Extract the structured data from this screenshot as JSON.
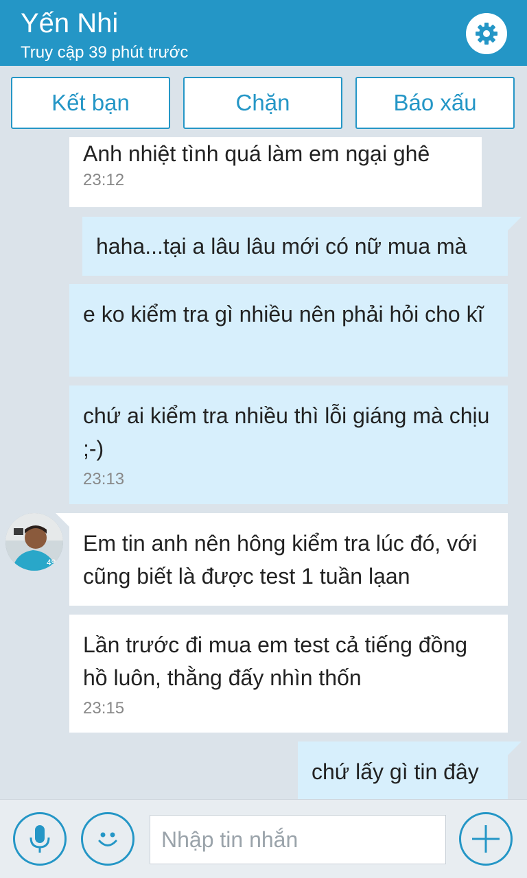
{
  "header": {
    "contact_name": "Yến Nhi",
    "last_seen": "Truy cập 39 phút trước",
    "settings_icon": "gear-icon"
  },
  "actions": {
    "add_friend": "Kết bạn",
    "block": "Chặn",
    "report": "Báo xấu"
  },
  "messages": [
    {
      "direction": "in",
      "text": "Anh nhiệt tình quá làm em ngại ghê",
      "time": "23:12"
    },
    {
      "direction": "out",
      "text": "haha...tại a lâu lâu mới có nữ mua mà",
      "time": ""
    },
    {
      "direction": "out",
      "text": "e ko kiểm tra gì nhiều nên phải hỏi cho kĩ",
      "time": ""
    },
    {
      "direction": "out",
      "text": "chứ ai kiểm tra nhiều thì lỗi giáng mà chịu ;-)",
      "time": "23:13"
    },
    {
      "direction": "in",
      "text": "Em tin anh nên hông kiểm tra lúc đó, với cũng biết là được test 1 tuần lạan",
      "time": ""
    },
    {
      "direction": "in",
      "text": "Lần trước đi mua em test cả tiếng đồng hồ luôn, thằng đấy nhìn thốn",
      "time": "23:15"
    },
    {
      "direction": "out",
      "text": "chứ lấy gì tin đây",
      "time": ""
    }
  ],
  "composer": {
    "placeholder": "Nhập tin nhắn",
    "value": "",
    "mic_icon": "microphone-icon",
    "emoji_icon": "smiley-icon",
    "add_icon": "plus-icon"
  },
  "colors": {
    "accent": "#2496c6",
    "background": "#dbe3ea",
    "incoming_bubble": "#ffffff",
    "outgoing_bubble": "#d7effc"
  }
}
